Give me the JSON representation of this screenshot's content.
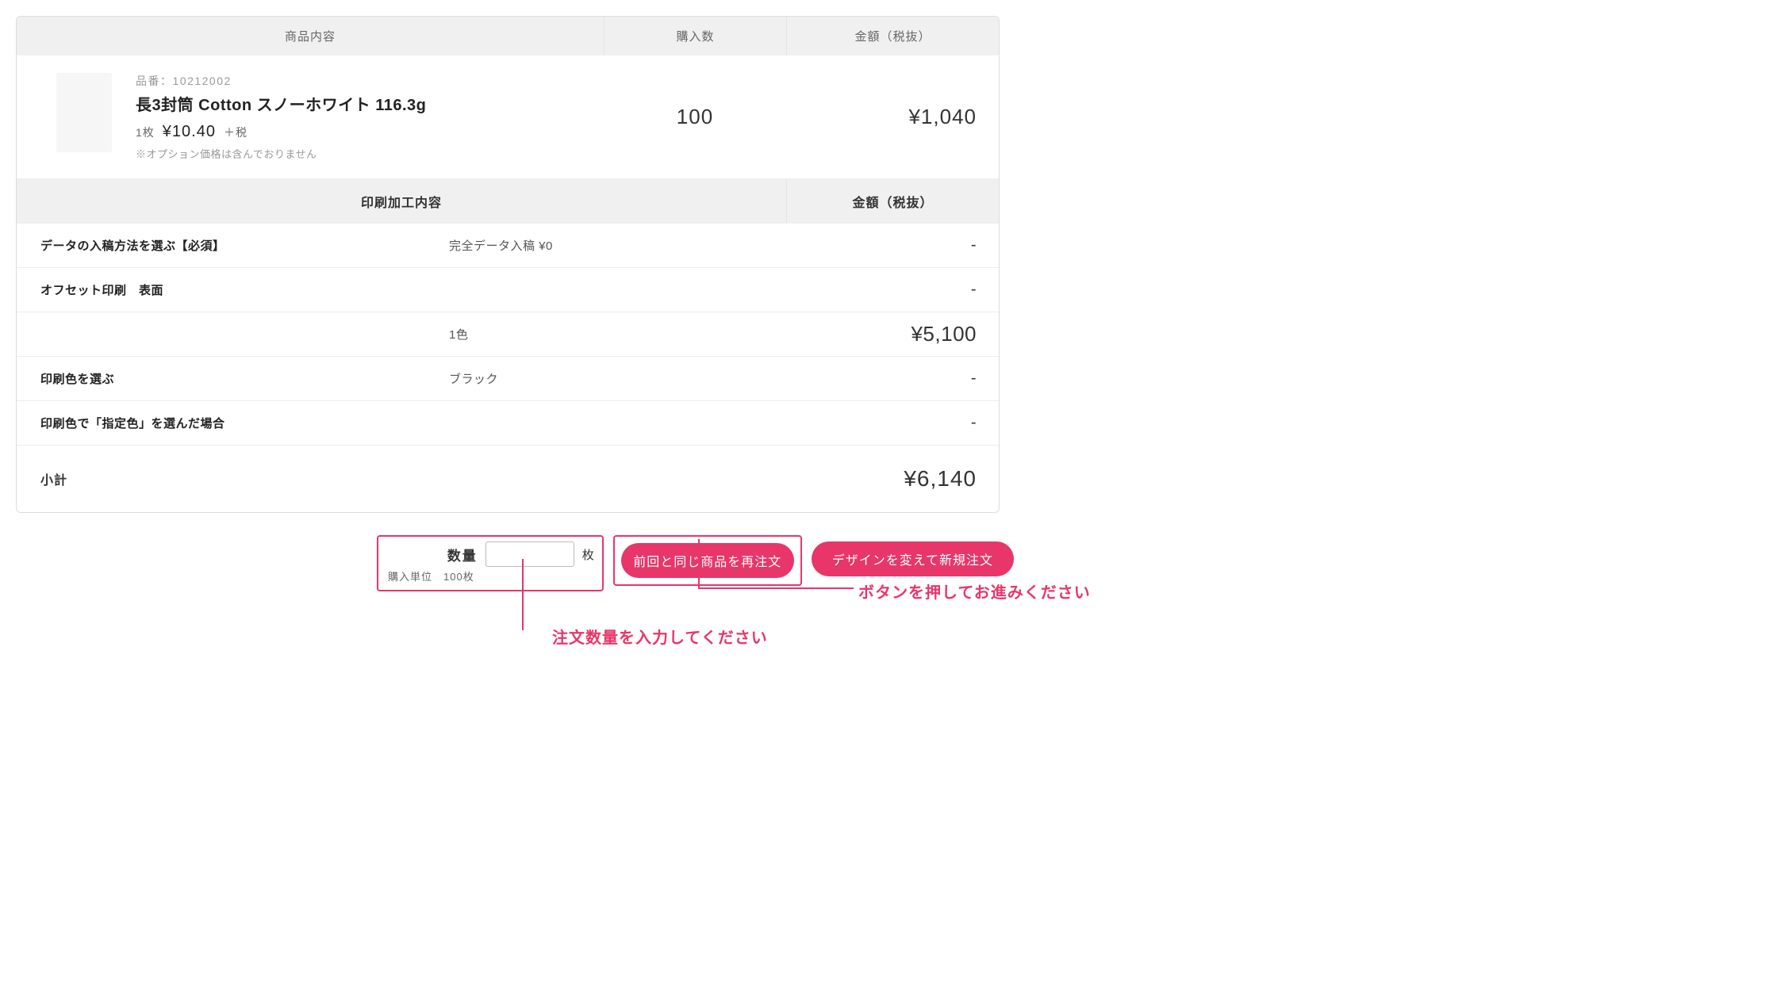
{
  "headers": {
    "product": "商品内容",
    "qty": "購入数",
    "price": "金額（税抜）"
  },
  "product": {
    "sku_label": "品番：10212002",
    "name": "長3封筒 Cotton スノーホワイト 116.3g",
    "unit_label": "1枚",
    "unit_price": "¥10.40",
    "unit_tax": "＋税",
    "note": "※オプション価格は含んでおりません",
    "qty": "100",
    "price": "¥1,040"
  },
  "processing_headers": {
    "desc": "印刷加工内容",
    "price": "金額（税抜）"
  },
  "options": [
    {
      "label": "データの入稿方法を選ぶ【必須】",
      "value": "完全データ入稿 ¥0",
      "price": "-"
    },
    {
      "label": "オフセット印刷　表面",
      "value": "",
      "price": "-"
    },
    {
      "label": "",
      "value": "1色",
      "price": "¥5,100"
    },
    {
      "label": "印刷色を選ぶ",
      "value": "ブラック",
      "price": "-"
    },
    {
      "label": "印刷色で「指定色」を選んだ場合",
      "value": "",
      "price": "-"
    }
  ],
  "subtotal": {
    "label": "小計",
    "value": "¥6,140"
  },
  "qty_box": {
    "title": "数量",
    "suffix": "枚",
    "unit_label": "購入単位",
    "unit_value": "100枚"
  },
  "buttons": {
    "reorder": "前回と同じ商品を再注文",
    "neworder": "デザインを変えて新規注文"
  },
  "callouts": {
    "button_note": "ボタンを押してお進みください",
    "qty_note": "注文数量を入力してください"
  }
}
